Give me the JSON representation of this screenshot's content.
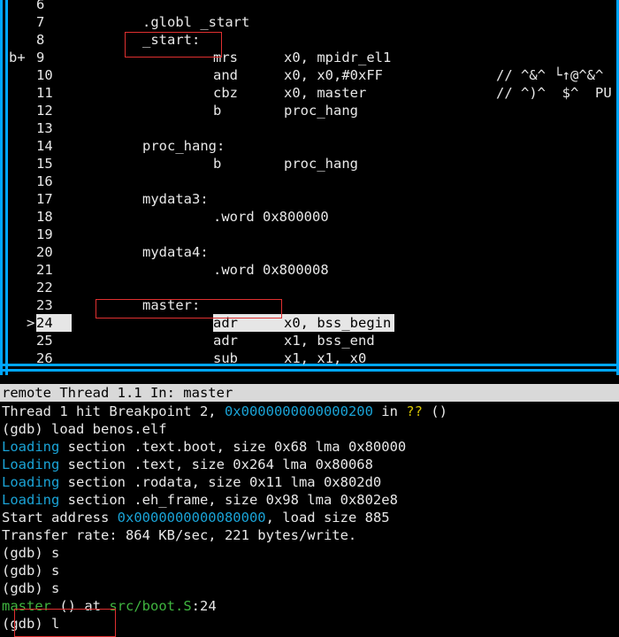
{
  "source": {
    "lines": [
      {
        "marker": "",
        "num": "6",
        "label": "",
        "op": "",
        "args": "",
        "comment": ""
      },
      {
        "marker": "",
        "num": "7",
        "label": ".globl _start",
        "op": "",
        "args": "",
        "comment": ""
      },
      {
        "marker": "",
        "num": "8",
        "label": "_start:",
        "op": "",
        "args": "",
        "comment": ""
      },
      {
        "marker": "b+",
        "num": "9",
        "label": "",
        "op": "mrs",
        "args": "x0, mpidr_el1",
        "comment": ""
      },
      {
        "marker": "",
        "num": "10",
        "label": "",
        "op": "and",
        "args": "x0, x0,#0xFF",
        "comment": "// ^&^ └↑@^&^"
      },
      {
        "marker": "",
        "num": "11",
        "label": "",
        "op": "cbz",
        "args": "x0, master",
        "comment": "// ^)^  $^  PU"
      },
      {
        "marker": "",
        "num": "12",
        "label": "",
        "op": "b",
        "args": "proc_hang",
        "comment": ""
      },
      {
        "marker": "",
        "num": "13",
        "label": "",
        "op": "",
        "args": "",
        "comment": ""
      },
      {
        "marker": "",
        "num": "14",
        "label": "proc_hang:",
        "op": "",
        "args": "",
        "comment": ""
      },
      {
        "marker": "",
        "num": "15",
        "label": "",
        "op": "b",
        "args": "proc_hang",
        "comment": ""
      },
      {
        "marker": "",
        "num": "16",
        "label": "",
        "op": "",
        "args": "",
        "comment": ""
      },
      {
        "marker": "",
        "num": "17",
        "label": "mydata3:",
        "op": "",
        "args": "",
        "comment": ""
      },
      {
        "marker": "",
        "num": "18",
        "label": "",
        "op": ".word 0x800000",
        "args": "",
        "comment": ""
      },
      {
        "marker": "",
        "num": "19",
        "label": "",
        "op": "",
        "args": "",
        "comment": ""
      },
      {
        "marker": "",
        "num": "20",
        "label": "mydata4:",
        "op": "",
        "args": "",
        "comment": ""
      },
      {
        "marker": "",
        "num": "21",
        "label": "",
        "op": ".word 0x800008",
        "args": "",
        "comment": ""
      },
      {
        "marker": "",
        "num": "22",
        "label": "",
        "op": "",
        "args": "",
        "comment": ""
      },
      {
        "marker": "",
        "num": "23",
        "label": "master:",
        "op": "",
        "args": "",
        "comment": ""
      },
      {
        "marker": ">",
        "num": "24",
        "label": "",
        "op": "adr",
        "args": "x0, bss_begin",
        "comment": ""
      },
      {
        "marker": "",
        "num": "25",
        "label": "",
        "op": "adr",
        "args": "x1, bss_end",
        "comment": ""
      },
      {
        "marker": "",
        "num": "26",
        "label": "",
        "op": "sub",
        "args": "x1, x1, x0",
        "comment": ""
      }
    ],
    "current_line": "24"
  },
  "status_bar": "remote Thread 1.1 In: master",
  "console": {
    "bp_a": "Thread 1 hit Breakpoint 2, ",
    "bp_addr": "0x0000000000000200",
    "bp_in": " in ",
    "bp_q": "??",
    "bp_end": " ()",
    "load_cmd": "(gdb) load benos.elf",
    "loading_word": "Loading",
    "sections": [
      " section .text.boot, size 0x68 lma 0x80000",
      " section .text, size 0x264 lma 0x80068",
      " section .rodata, size 0x11 lma 0x802d0",
      " section .eh_frame, size 0x98 lma 0x802e8"
    ],
    "start_a": "Start address ",
    "start_addr": "0x0000000000080000",
    "start_b": ", load size 885",
    "transfer": "Transfer rate: 864 KB/sec, 221 bytes/write.",
    "s_cmd": "(gdb) s",
    "frame_fn": "master",
    "frame_mid": " () at ",
    "frame_file": "src/boot.S",
    "frame_line": ":24",
    "l_cmd": "(gdb) l"
  },
  "colors": {
    "accent": "#00a6ff",
    "address": "#1aa3d6",
    "highlight": "#e03030"
  }
}
